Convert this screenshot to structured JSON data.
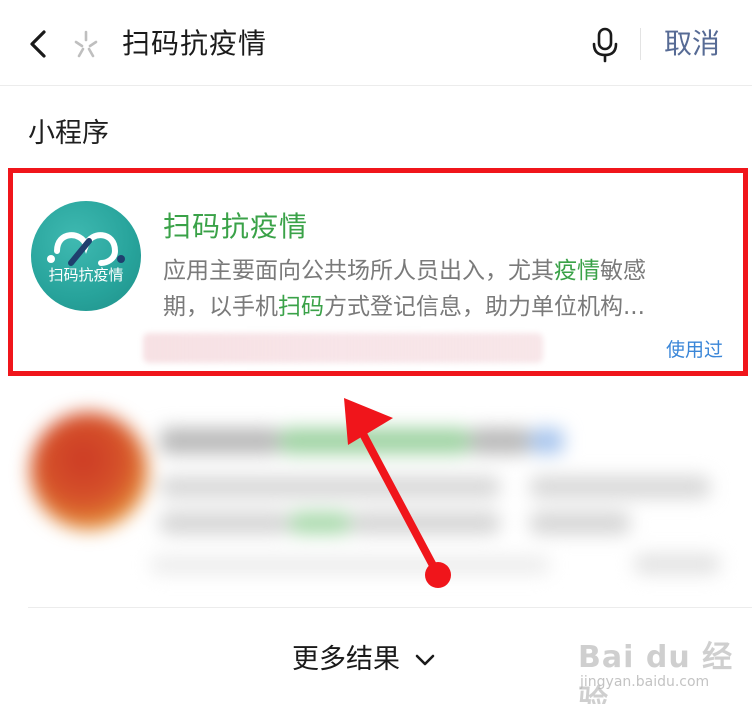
{
  "search_bar": {
    "query": "扫码抗疫情",
    "cancel_label": "取消",
    "back_icon": "chevron-left-icon",
    "spark_icon": "sparkle-icon",
    "mic_icon": "microphone-icon"
  },
  "section": {
    "title": "小程序"
  },
  "result": {
    "title": "扫码抗疫情",
    "logo_text": "扫码抗疫情",
    "desc_line1": [
      "应用主要面向公共场所人员出入，尤其",
      "疫情",
      "敏感"
    ],
    "desc_line2": [
      "期，以手机",
      "扫码",
      "方式登记信息，助力单位机构..."
    ],
    "used_badge": "使用过"
  },
  "footer": {
    "more_results": "更多结果",
    "more_icon": "chevron-down-icon"
  },
  "watermark": {
    "brand": "Bai du 经验",
    "site": "jingyan.baidu.com"
  },
  "colors": {
    "highlight_green": "#3aa248",
    "link_blue": "#576b95",
    "badge_blue": "#3a86d8",
    "annotation_red": "#f0151b",
    "logo_teal": "#27a39b"
  }
}
